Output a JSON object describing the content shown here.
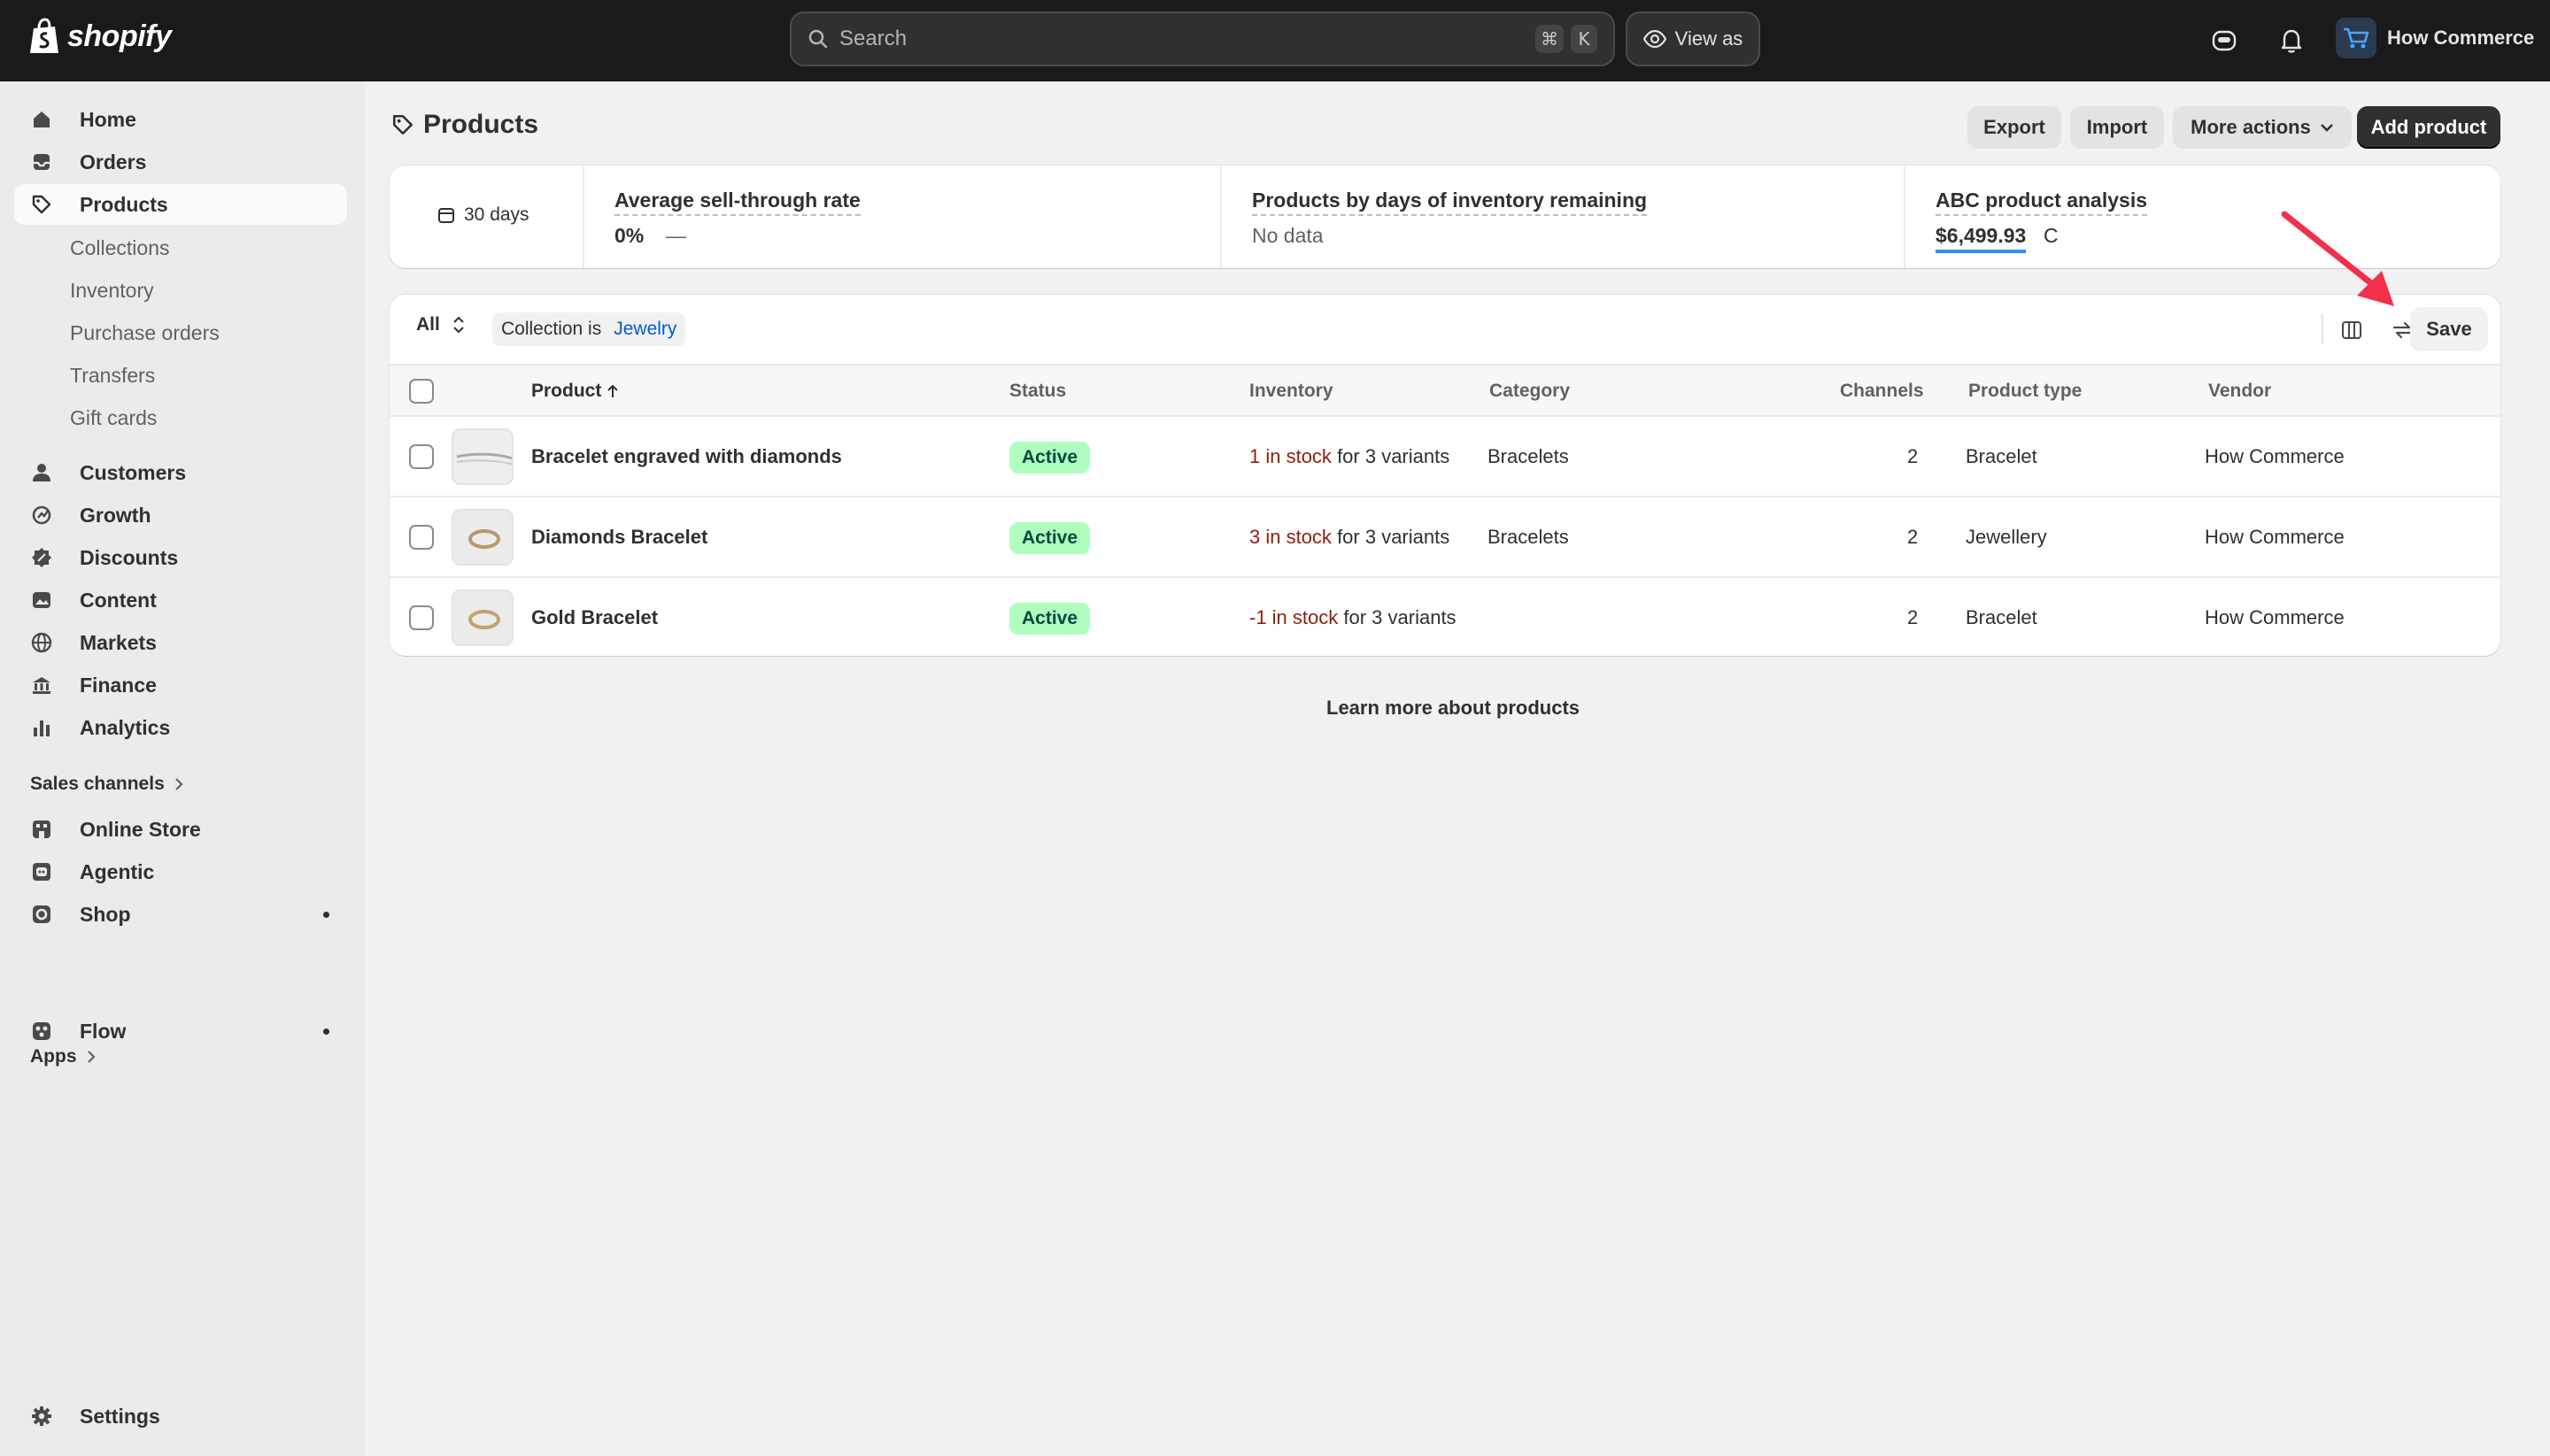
{
  "topbar": {
    "logo_text": "shopify",
    "search_placeholder": "Search",
    "shortcut_keys": [
      "⌘",
      "K"
    ],
    "view_as_label": "View as",
    "store_name": "How Commerce"
  },
  "sidebar": {
    "main_items": [
      {
        "label": "Home",
        "icon": "home-icon"
      },
      {
        "label": "Orders",
        "icon": "inbox-icon"
      },
      {
        "label": "Products",
        "icon": "tag-icon",
        "active": true
      }
    ],
    "product_sub_items": [
      "Collections",
      "Inventory",
      "Purchase orders",
      "Transfers",
      "Gift cards"
    ],
    "more_items": [
      {
        "label": "Customers",
        "icon": "person-icon"
      },
      {
        "label": "Growth",
        "icon": "growth-icon"
      },
      {
        "label": "Discounts",
        "icon": "discount-icon"
      },
      {
        "label": "Content",
        "icon": "content-icon"
      },
      {
        "label": "Markets",
        "icon": "globe-icon"
      },
      {
        "label": "Finance",
        "icon": "bank-icon"
      },
      {
        "label": "Analytics",
        "icon": "chart-icon"
      }
    ],
    "sales_channels_title": "Sales channels",
    "channels": [
      {
        "label": "Online Store",
        "icon": "store-icon"
      },
      {
        "label": "Agentic",
        "icon": "agentic-icon"
      },
      {
        "label": "Shop",
        "icon": "shop-icon",
        "dot": true
      }
    ],
    "apps_title": "Apps",
    "apps": [
      {
        "label": "Flow",
        "icon": "flow-icon",
        "dot": true
      }
    ],
    "settings_label": "Settings"
  },
  "page": {
    "title": "Products",
    "actions": {
      "export": "Export",
      "import": "Import",
      "more_actions": "More actions",
      "add_product": "Add product"
    }
  },
  "metrics": {
    "period": "30 days",
    "sell_through": {
      "label": "Average sell-through rate",
      "value": "0%",
      "trend": "—"
    },
    "days_inventory": {
      "label": "Products by days of inventory remaining",
      "value": "No data"
    },
    "abc": {
      "label": "ABC product analysis",
      "value": "$6,499.93",
      "suffix": "C"
    }
  },
  "filters": {
    "view": "All",
    "chip_label": "Collection is",
    "chip_value": "Jewelry",
    "save_label": "Save"
  },
  "table": {
    "headers": {
      "product": "Product",
      "status": "Status",
      "inventory": "Inventory",
      "category": "Category",
      "channels": "Channels",
      "product_type": "Product type",
      "vendor": "Vendor"
    },
    "rows": [
      {
        "name": "Bracelet engraved with diamonds",
        "status": "Active",
        "stock": "1 in stock",
        "variants": "for 3 variants",
        "category": "Bracelets",
        "channels": "2",
        "type": "Bracelet",
        "vendor": "How Commerce"
      },
      {
        "name": "Diamonds Bracelet",
        "status": "Active",
        "stock": "3 in stock",
        "variants": "for 3 variants",
        "category": "Bracelets",
        "channels": "2",
        "type": "Jewellery",
        "vendor": "How Commerce"
      },
      {
        "name": "Gold Bracelet",
        "status": "Active",
        "stock": "-1 in stock",
        "variants": "for 3 variants",
        "category": "",
        "channels": "2",
        "type": "Bracelet",
        "vendor": "How Commerce"
      }
    ]
  },
  "footer_link": "Learn more about products",
  "colors": {
    "topbar": "#1a1a1a",
    "accent_link": "#005bd3",
    "badge_bg": "#affebf",
    "stock_text": "#8e1f0b",
    "annotation_arrow": "#f2304a"
  }
}
